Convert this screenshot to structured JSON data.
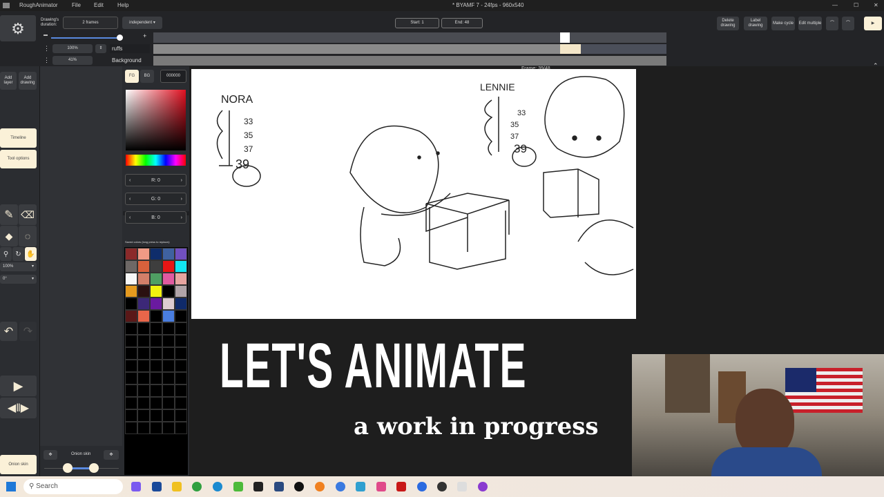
{
  "titlebar": {
    "app": "RoughAnimator",
    "menu": [
      "File",
      "Edit",
      "Help"
    ],
    "doc_title": "* BYAMF 7 - 24fps - 960x540",
    "min": "—",
    "max": "☐",
    "close": "✕"
  },
  "toolbar": {
    "drawing_duration_label": "Drawing's duration:",
    "duration_value": "2 frames",
    "mode": "independent",
    "start": "Start: 1",
    "end": "End: 48",
    "delete_drawing": "Delete drawing",
    "label_drawing": "Label drawing",
    "make_cycle": "Make cycle",
    "edit_multiple": "Edit multiple"
  },
  "layers": [
    {
      "opacity": "100%",
      "name": "ruffs"
    },
    {
      "opacity": "41%",
      "name": "Background"
    }
  ],
  "frame_counter": "Frame: 39/48",
  "left": {
    "add_layer": "Add layer",
    "add_drawing": "Add drawing",
    "timeline": "Timeline",
    "tool_options": "Tool options",
    "zoom": "100%",
    "rotation": "0°",
    "onion_skin": "Onion skin"
  },
  "onion": {
    "label": "Onion skin"
  },
  "color": {
    "fg": "FG",
    "bg": "BG",
    "hex": "000000",
    "r": "R: 0",
    "g": "G: 0",
    "b": "B: 0",
    "saved_label": "Saved colors (long press to replace):",
    "swatches": [
      "#8b2a2a",
      "#f09a85",
      "#0f2d6b",
      "#3f62a0",
      "#7150c0",
      "#6e6866",
      "#d9613c",
      "#3e3e3e",
      "#e81515",
      "#12e6f2",
      "#f8f8f8",
      "#d27f69",
      "#4f9f63",
      "#e05aa0",
      "#e7a5a0",
      "#e59a1f",
      "#2a1010",
      "#f2f20f",
      "#000000",
      "#b0a4a8",
      "#000000",
      "#3c2878",
      "#6a1aa0",
      "#dcccd0",
      "#0f2a6a",
      "#5a1818",
      "#e8664a",
      "#000000",
      "#4a7ee0",
      "#000000"
    ]
  },
  "sketch": {
    "nora": "NORA",
    "lennie": "LENNIE",
    "nora_nums": [
      "33",
      "35",
      "37",
      "39"
    ],
    "lennie_nums": [
      "33",
      "35",
      "37",
      "39"
    ]
  },
  "overlay": {
    "title": "LET'S ANIMATE",
    "subtitle": "a work in progress"
  },
  "taskbar": {
    "search": "Search"
  }
}
